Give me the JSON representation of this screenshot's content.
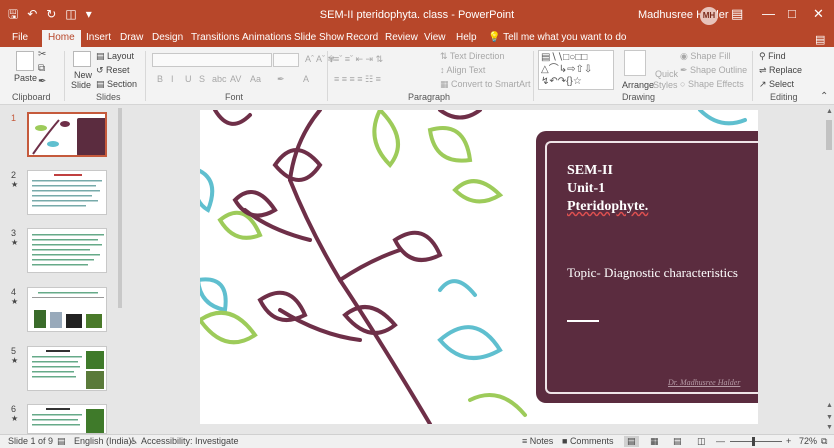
{
  "window": {
    "title": "SEM-II pteridophyta. class - PowerPoint",
    "user_name": "Madhusree Halder",
    "user_initials": "MH",
    "quick_access": [
      "save-icon",
      "undo-icon",
      "redo-icon",
      "present-icon",
      "customize-icon"
    ],
    "controls": [
      "ribbon-display-icon",
      "minimize-icon",
      "maximize-icon",
      "close-icon"
    ]
  },
  "tabs": [
    "File",
    "Home",
    "Insert",
    "Draw",
    "Design",
    "Transitions",
    "Animations",
    "Slide Show",
    "Record",
    "Review",
    "View",
    "Help"
  ],
  "active_tab": "Home",
  "tell_me": "Tell me what you want to do",
  "ribbon": {
    "clipboard": {
      "label": "Clipboard",
      "paste": "Paste"
    },
    "slides": {
      "label": "Slides",
      "new_slide_1": "New",
      "new_slide_2": "Slide",
      "layout": "Layout",
      "reset": "Reset",
      "section": "Section"
    },
    "font": {
      "label": "Font",
      "buttons": [
        "B",
        "I",
        "U",
        "S",
        "abc",
        "AV",
        "Aa",
        "A"
      ]
    },
    "paragraph": {
      "label": "Paragraph",
      "text_direction": "Text Direction",
      "align_text": "Align Text",
      "convert_smartart": "Convert to SmartArt"
    },
    "drawing": {
      "label": "Drawing",
      "arrange": "Arrange",
      "quick_styles_1": "Quick",
      "quick_styles_2": "Styles",
      "shape_fill": "Shape Fill",
      "shape_outline": "Shape Outline",
      "shape_effects": "Shape Effects"
    },
    "editing": {
      "label": "Editing",
      "find": "Find",
      "replace": "Replace",
      "select": "Select"
    }
  },
  "thumbnails": [
    {
      "number": "1",
      "selected": true
    },
    {
      "number": "2"
    },
    {
      "number": "3"
    },
    {
      "number": "4"
    },
    {
      "number": "5"
    },
    {
      "number": "6"
    }
  ],
  "slide": {
    "title_line1": "SEM-II",
    "title_line2": "Unit-1",
    "title_line3": "Pteridophyte.",
    "topic": "Topic- Diagnostic characteristics",
    "signature": "Dr. Madhusree Halder",
    "colors": {
      "panel": "#5b2c3f",
      "leaf_dark": "#6e2f48",
      "leaf_green": "#9dcb5a",
      "leaf_teal": "#5fbfcf"
    }
  },
  "statusbar": {
    "slide_info": "Slide 1 of 9",
    "language": "English (India)",
    "accessibility": "Accessibility: Investigate",
    "notes": "Notes",
    "comments": "Comments",
    "zoom": "72%"
  }
}
